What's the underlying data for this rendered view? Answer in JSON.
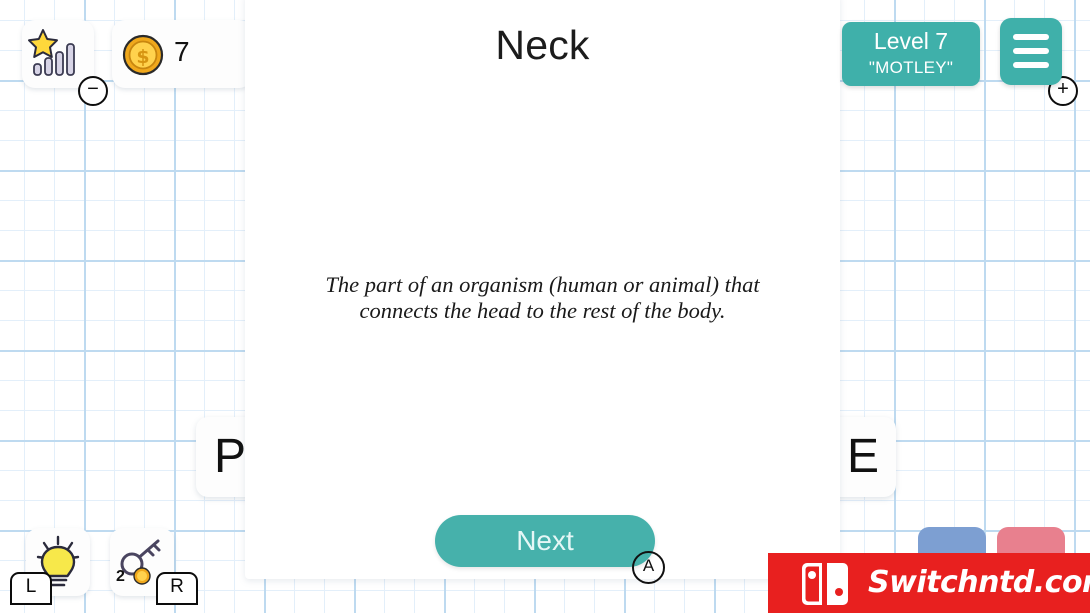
{
  "hud": {
    "difficulty_icon": "star-signal-bars-icon",
    "difficulty_decrease_label": "−",
    "difficulty_increase_label": "+",
    "coin_icon": "gold-coin-icon",
    "coin_count": "7"
  },
  "level": {
    "number_label": "Level 7",
    "word_label": "\"MOTLEY\"",
    "badge_color": "#3fb0aa"
  },
  "menu": {
    "icon": "hamburger-menu-icon"
  },
  "card": {
    "word": "Neck",
    "definition": "The part of an organism (human or animal) that connects the head to the rest of the body.",
    "next_label": "Next",
    "next_color": "#46b1ab",
    "a_button_label": "A"
  },
  "tiles": [
    {
      "letter": "P"
    },
    {
      "letter": "E"
    }
  ],
  "bottom_bar": {
    "hint_icon": "lightbulb-icon",
    "hint_shoulder_label": "L",
    "key_icon": "key-icon",
    "key_cost": "2",
    "key_cost_coin_icon": "gold-coin-icon",
    "key_shoulder_label": "R",
    "pill_blue_color": "#7d9fd2",
    "pill_pink_color": "#e8808e"
  },
  "watermark": {
    "logo": "nintendo-switch-logo",
    "text": "Switchntd.com",
    "background_color": "#e8201f"
  }
}
